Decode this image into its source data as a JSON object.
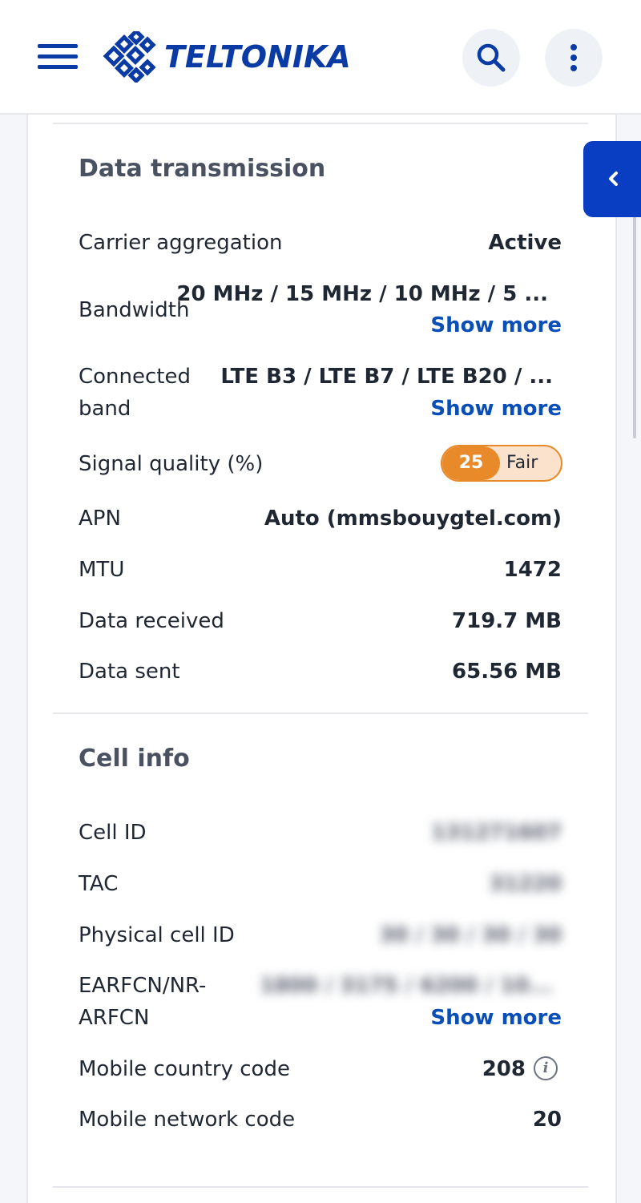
{
  "header": {
    "menu_icon": "hamburger-menu-icon",
    "logo_text": "TELTONIKA",
    "search_icon": "search-icon",
    "more_icon": "vertical-dots-icon",
    "brand_color": "#0a3aa4"
  },
  "side_tab": {
    "icon": "chevron-left-icon"
  },
  "data_transmission": {
    "title": "Data transmission",
    "carrier_aggregation": {
      "label": "Carrier aggregation",
      "value": "Active"
    },
    "bandwidth": {
      "label": "Bandwidth",
      "value": "20 MHz / 15 MHz / 10 MHz / 5 ...",
      "more": "Show more"
    },
    "connected_band": {
      "label_line1": "Connected",
      "label_line2": "band",
      "value": "LTE B3 / LTE B7 / LTE B20 / ...",
      "more": "Show more"
    },
    "signal_quality": {
      "label": "Signal quality (%)",
      "value": "25",
      "status": "Fair",
      "color": "#e88a2a"
    },
    "apn": {
      "label": "APN",
      "value": "Auto (mmsbouygtel.com)"
    },
    "mtu": {
      "label": "MTU",
      "value": "1472"
    },
    "data_received": {
      "label": "Data received",
      "value": "719.7 MB"
    },
    "data_sent": {
      "label": "Data sent",
      "value": "65.56 MB"
    }
  },
  "cell_info": {
    "title": "Cell info",
    "cell_id": {
      "label": "Cell ID",
      "value": "131271607"
    },
    "tac": {
      "label": "TAC",
      "value": "31220"
    },
    "physical_cell_id": {
      "label": "Physical cell ID",
      "value": "30 / 30 / 30 / 30"
    },
    "earfcn": {
      "label_line1": "EARFCN/NR-",
      "label_line2": "ARFCN",
      "value": "1800 / 3175 / 6200 / 10...",
      "more": "Show more"
    },
    "mcc": {
      "label": "Mobile country code",
      "value": "208"
    },
    "mnc": {
      "label": "Mobile network code",
      "value": "20"
    }
  }
}
